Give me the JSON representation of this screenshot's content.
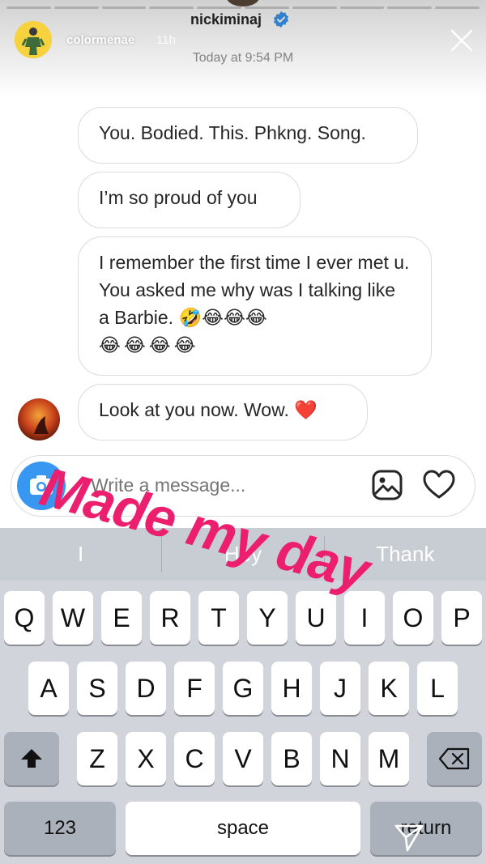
{
  "story": {
    "poster_name": "colormenae",
    "poster_age": "11h",
    "overlay_text": "Made my day"
  },
  "chat": {
    "header_name": "nickiminaj",
    "timestamp": "Today at 9:54 PM",
    "messages": [
      {
        "text": "You. Bodied. This. Phkng. Song."
      },
      {
        "text": "I’m so proud of you"
      },
      {
        "text": "I remember the first time I ever met u. You asked me why was I talking like a Barbie. 🤣😂😂😂",
        "emoji_line": "😂😂😂😂"
      },
      {
        "text": "Look at you now. Wow. ❤️"
      }
    ],
    "composer_placeholder": "Write a message..."
  },
  "keyboard": {
    "suggestions": [
      "I",
      "Hey",
      "Thank"
    ],
    "row1": [
      "Q",
      "W",
      "E",
      "R",
      "T",
      "Y",
      "U",
      "I",
      "O",
      "P"
    ],
    "row2": [
      "A",
      "S",
      "D",
      "F",
      "G",
      "H",
      "J",
      "K",
      "L"
    ],
    "row3": [
      "Z",
      "X",
      "C",
      "V",
      "B",
      "N",
      "M"
    ],
    "numbers_label": "123",
    "space_label": "space",
    "return_label": "return"
  },
  "colors": {
    "accent_blue": "#3897f0",
    "overlay_pink": "#ec1f6f",
    "verified_blue": "#3897f0"
  }
}
